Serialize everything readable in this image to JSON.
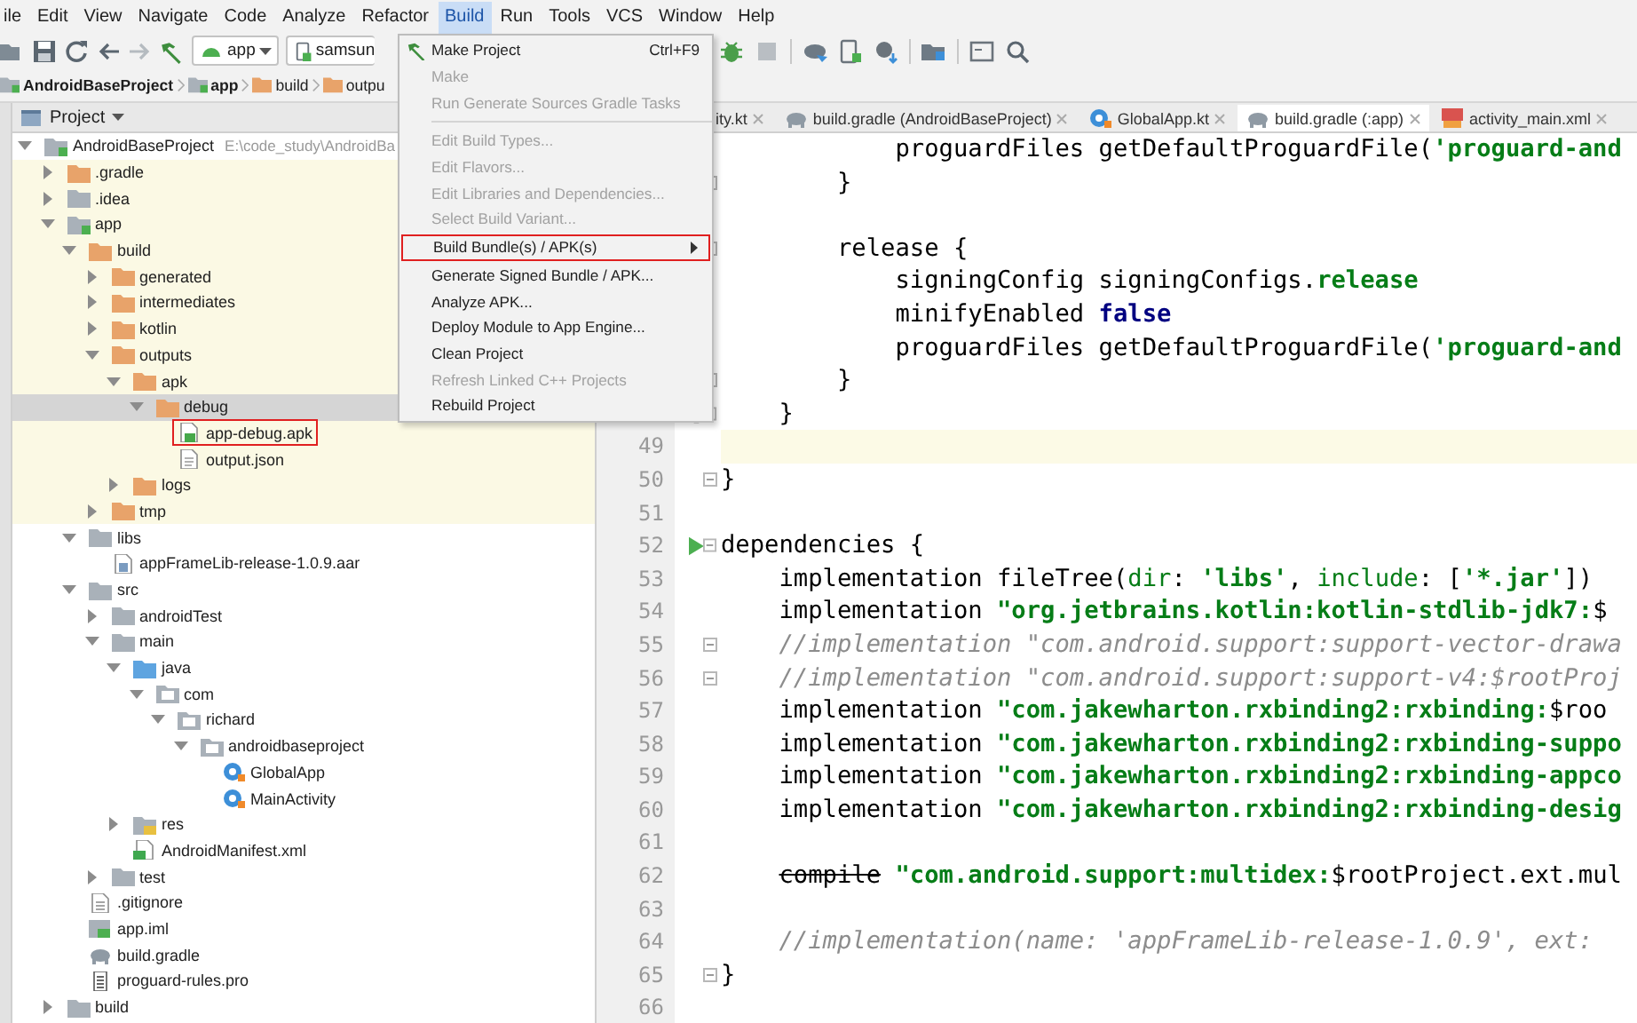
{
  "menu_bar": [
    {
      "label": "ile",
      "selected": false
    },
    {
      "label": "Edit",
      "selected": false
    },
    {
      "label": "View",
      "selected": false
    },
    {
      "label": "Navigate",
      "selected": false
    },
    {
      "label": "Code",
      "selected": false
    },
    {
      "label": "Analyze",
      "selected": false
    },
    {
      "label": "Refactor",
      "selected": false
    },
    {
      "label": "Build",
      "selected": true
    },
    {
      "label": "Run",
      "selected": false
    },
    {
      "label": "Tools",
      "selected": false
    },
    {
      "label": "VCS",
      "selected": false
    },
    {
      "label": "Window",
      "selected": false
    },
    {
      "label": "Help",
      "selected": false
    }
  ],
  "toolbar": {
    "run_config": "app",
    "device": "samsun"
  },
  "breadcrumb": [
    {
      "label": "AndroidBaseProject",
      "kind": "module"
    },
    {
      "label": "app",
      "kind": "module"
    },
    {
      "label": "build",
      "kind": "build-folder"
    },
    {
      "label": "outpu",
      "kind": "build-folder"
    }
  ],
  "project_panel": {
    "title": "Project",
    "tree": [
      {
        "label": "AndroidBaseProject",
        "path": "E:\\code_study\\AndroidBa",
        "kind": "module",
        "expanded": true,
        "selected": false,
        "shaded": false,
        "annotated": false,
        "children": [
          {
            "label": ".gradle",
            "kind": "build-folder",
            "expanded": false,
            "selected": false,
            "shaded": true,
            "annotated": false
          },
          {
            "label": ".idea",
            "kind": "folder",
            "expanded": false,
            "selected": false,
            "shaded": true,
            "annotated": false
          },
          {
            "label": "app",
            "kind": "module",
            "expanded": true,
            "selected": false,
            "shaded": true,
            "annotated": false,
            "children": [
              {
                "label": "build",
                "kind": "build-folder",
                "expanded": true,
                "selected": false,
                "shaded": true,
                "annotated": false,
                "children": [
                  {
                    "label": "generated",
                    "kind": "build-folder",
                    "expanded": false,
                    "selected": false,
                    "shaded": true,
                    "annotated": false
                  },
                  {
                    "label": "intermediates",
                    "kind": "build-folder",
                    "expanded": false,
                    "selected": false,
                    "shaded": true,
                    "annotated": false
                  },
                  {
                    "label": "kotlin",
                    "kind": "build-folder",
                    "expanded": false,
                    "selected": false,
                    "shaded": true,
                    "annotated": false
                  },
                  {
                    "label": "outputs",
                    "kind": "build-folder",
                    "expanded": true,
                    "selected": false,
                    "shaded": true,
                    "annotated": false,
                    "children": [
                      {
                        "label": "apk",
                        "kind": "build-folder",
                        "expanded": true,
                        "selected": false,
                        "shaded": true,
                        "annotated": false,
                        "children": [
                          {
                            "label": "debug",
                            "kind": "build-folder",
                            "expanded": true,
                            "selected": true,
                            "annotated": false,
                            "children": [
                              {
                                "label": "app-debug.apk",
                                "kind": "apk",
                                "selected": false,
                                "shaded": true,
                                "annotated": true
                              },
                              {
                                "label": "output.json",
                                "kind": "json",
                                "selected": false,
                                "shaded": true,
                                "annotated": false
                              }
                            ]
                          }
                        ]
                      },
                      {
                        "label": "logs",
                        "kind": "build-folder",
                        "expanded": false,
                        "selected": false,
                        "shaded": true,
                        "annotated": false
                      }
                    ]
                  },
                  {
                    "label": "tmp",
                    "kind": "build-folder",
                    "expanded": false,
                    "selected": false,
                    "shaded": true,
                    "annotated": false
                  }
                ]
              },
              {
                "label": "libs",
                "kind": "folder",
                "expanded": true,
                "selected": false,
                "shaded": false,
                "annotated": false,
                "children": [
                  {
                    "label": "appFrameLib-release-1.0.9.aar",
                    "kind": "aar",
                    "selected": false,
                    "shaded": false,
                    "annotated": false
                  }
                ]
              },
              {
                "label": "src",
                "kind": "folder",
                "expanded": true,
                "selected": false,
                "shaded": false,
                "annotated": false,
                "children": [
                  {
                    "label": "androidTest",
                    "kind": "folder",
                    "expanded": false,
                    "selected": false,
                    "shaded": false,
                    "annotated": false
                  },
                  {
                    "label": "main",
                    "kind": "folder",
                    "expanded": true,
                    "selected": false,
                    "shaded": false,
                    "annotated": false,
                    "children": [
                      {
                        "label": "java",
                        "kind": "source-folder",
                        "expanded": true,
                        "selected": false,
                        "shaded": false,
                        "annotated": false,
                        "children": [
                          {
                            "label": "com",
                            "kind": "package",
                            "expanded": true,
                            "selected": false,
                            "shaded": false,
                            "annotated": false,
                            "children": [
                              {
                                "label": "richard",
                                "kind": "package",
                                "expanded": true,
                                "selected": false,
                                "shaded": false,
                                "annotated": false,
                                "children": [
                                  {
                                    "label": "androidbaseproject",
                                    "kind": "package",
                                    "expanded": true,
                                    "selected": false,
                                    "shaded": false,
                                    "annotated": false,
                                    "children": [
                                      {
                                        "label": "GlobalApp",
                                        "kind": "kotlin-class",
                                        "selected": false,
                                        "shaded": false,
                                        "annotated": false
                                      },
                                      {
                                        "label": "MainActivity",
                                        "kind": "kotlin-class",
                                        "selected": false,
                                        "shaded": false,
                                        "annotated": false
                                      }
                                    ]
                                  }
                                ]
                              }
                            ]
                          }
                        ]
                      },
                      {
                        "label": "res",
                        "kind": "res-folder",
                        "expanded": false,
                        "selected": false,
                        "shaded": false,
                        "annotated": false
                      },
                      {
                        "label": "AndroidManifest.xml",
                        "kind": "manifest",
                        "selected": false,
                        "shaded": false,
                        "annotated": false
                      }
                    ]
                  },
                  {
                    "label": "test",
                    "kind": "folder",
                    "expanded": false,
                    "selected": false,
                    "shaded": false,
                    "annotated": false
                  }
                ]
              },
              {
                "label": ".gitignore",
                "kind": "text",
                "selected": false,
                "shaded": false,
                "annotated": false
              },
              {
                "label": "app.iml",
                "kind": "iml",
                "selected": false,
                "shaded": false,
                "annotated": false
              },
              {
                "label": "build.gradle",
                "kind": "gradle",
                "selected": false,
                "shaded": false,
                "annotated": false
              },
              {
                "label": "proguard-rules.pro",
                "kind": "pro",
                "selected": false,
                "shaded": false,
                "annotated": false
              }
            ]
          },
          {
            "label": "build",
            "kind": "folder",
            "expanded": false,
            "selected": false,
            "shaded": false,
            "annotated": false
          }
        ]
      }
    ]
  },
  "build_menu": [
    {
      "kind": "hammer-item",
      "label": "Make Project",
      "shortcut": "Ctrl+F9",
      "disabled": false,
      "submenu": false,
      "annotated": false
    },
    {
      "kind": "item",
      "label": "Make",
      "disabled": true,
      "submenu": false,
      "annotated": false
    },
    {
      "kind": "item",
      "label": "Run Generate Sources Gradle Tasks",
      "disabled": true,
      "submenu": false,
      "annotated": false
    },
    {
      "kind": "separator"
    },
    {
      "kind": "item",
      "label": "Edit Build Types...",
      "disabled": true,
      "submenu": false,
      "annotated": false
    },
    {
      "kind": "item",
      "label": "Edit Flavors...",
      "disabled": true,
      "submenu": false,
      "annotated": false
    },
    {
      "kind": "item",
      "label": "Edit Libraries and Dependencies...",
      "disabled": true,
      "submenu": false,
      "annotated": false
    },
    {
      "kind": "item",
      "label": "Select Build Variant...",
      "disabled": true,
      "submenu": false,
      "annotated": false
    },
    {
      "kind": "item",
      "label": "Build Bundle(s) / APK(s)",
      "disabled": false,
      "submenu": true,
      "annotated": true
    },
    {
      "kind": "item",
      "label": "Generate Signed Bundle / APK...",
      "disabled": false,
      "submenu": false,
      "annotated": false
    },
    {
      "kind": "item",
      "label": "Analyze APK...",
      "disabled": false,
      "submenu": false,
      "annotated": false
    },
    {
      "kind": "item",
      "label": "Deploy Module to App Engine...",
      "disabled": false,
      "submenu": false,
      "annotated": false
    },
    {
      "kind": "item",
      "label": "Clean Project",
      "disabled": false,
      "submenu": false,
      "annotated": false
    },
    {
      "kind": "item",
      "label": "Refresh Linked C++ Projects",
      "disabled": true,
      "submenu": false,
      "annotated": false
    },
    {
      "kind": "item",
      "label": "Rebuild Project",
      "disabled": false,
      "submenu": false,
      "annotated": false
    }
  ],
  "editor": {
    "tabs": [
      {
        "label": "ity.kt",
        "kind": "plain",
        "selected": false
      },
      {
        "label": "build.gradle (AndroidBaseProject)",
        "kind": "gradle",
        "selected": false
      },
      {
        "label": "GlobalApp.kt",
        "kind": "kotlin-class",
        "selected": false
      },
      {
        "label": "build.gradle (:app)",
        "kind": "gradle",
        "selected": true
      },
      {
        "label": "activity_main.xml",
        "kind": "layout",
        "selected": false
      }
    ],
    "lines": [
      {
        "kind": "code",
        "current": false,
        "fold": false,
        "segments": [
          {
            "kind": "plain",
            "text": "            proguardFiles getDefaultProguardFile("
          },
          {
            "kind": "string",
            "text": "'proguard-and"
          }
        ]
      },
      {
        "kind": "code",
        "current": false,
        "fold": true,
        "segments": [
          {
            "kind": "plain",
            "text": "        }"
          }
        ]
      },
      {
        "kind": "code",
        "current": false,
        "fold": false
      },
      {
        "kind": "code",
        "current": false,
        "fold": true,
        "segments": [
          {
            "kind": "plain",
            "text": "        release {"
          }
        ]
      },
      {
        "kind": "code",
        "current": false,
        "fold": false,
        "segments": [
          {
            "kind": "plain",
            "text": "            signingConfig signingConfigs."
          },
          {
            "kind": "string",
            "text": "release"
          }
        ]
      },
      {
        "kind": "code",
        "current": false,
        "fold": false,
        "segments": [
          {
            "kind": "plain",
            "text": "            minifyEnabled "
          },
          {
            "kind": "keyword",
            "text": "false"
          }
        ]
      },
      {
        "kind": "code",
        "current": false,
        "fold": false,
        "segments": [
          {
            "kind": "plain",
            "text": "            proguardFiles getDefaultProguardFile("
          },
          {
            "kind": "string",
            "text": "'proguard-and"
          }
        ]
      },
      {
        "kind": "code",
        "current": false,
        "fold": true,
        "segments": [
          {
            "kind": "plain",
            "text": "        }"
          }
        ]
      },
      {
        "kind": "bulb",
        "current": false,
        "fold": true,
        "segments": [
          {
            "kind": "plain",
            "text": "    }"
          }
        ]
      },
      {
        "kind": "code",
        "number": "49",
        "current": true,
        "fold": false
      },
      {
        "kind": "code",
        "number": "50",
        "current": false,
        "fold": true,
        "segments": [
          {
            "kind": "plain",
            "text": "}"
          }
        ]
      },
      {
        "kind": "code",
        "number": "51",
        "current": false,
        "fold": false
      },
      {
        "kind": "run",
        "number": "52",
        "current": false,
        "fold": true,
        "segments": [
          {
            "kind": "plain",
            "text": "dependencies {"
          }
        ]
      },
      {
        "kind": "code",
        "number": "53",
        "current": false,
        "fold": false,
        "segments": [
          {
            "kind": "plain",
            "text": "    implementation fileTree("
          },
          {
            "kind": "named-arg",
            "text": "dir"
          },
          {
            "kind": "plain",
            "text": ": "
          },
          {
            "kind": "string",
            "text": "'libs'"
          },
          {
            "kind": "plain",
            "text": ", "
          },
          {
            "kind": "named-arg",
            "text": "include"
          },
          {
            "kind": "plain",
            "text": ": ["
          },
          {
            "kind": "string",
            "text": "'*.jar'"
          },
          {
            "kind": "plain",
            "text": "])"
          }
        ]
      },
      {
        "kind": "code",
        "number": "54",
        "current": false,
        "fold": false,
        "segments": [
          {
            "kind": "plain",
            "text": "    implementation "
          },
          {
            "kind": "string",
            "text": "\"org.jetbrains.kotlin:kotlin-stdlib-jdk7:"
          },
          {
            "kind": "plain",
            "text": "$"
          }
        ]
      },
      {
        "kind": "code",
        "number": "55",
        "current": false,
        "fold": true,
        "segments": [
          {
            "kind": "comment",
            "text": "    //implementation \"com.android.support:support-vector-drawa"
          }
        ]
      },
      {
        "kind": "code",
        "number": "56",
        "current": false,
        "fold": true,
        "segments": [
          {
            "kind": "comment",
            "text": "    //implementation \"com.android.support:support-v4:$rootProj"
          }
        ]
      },
      {
        "kind": "code",
        "number": "57",
        "current": false,
        "fold": false,
        "segments": [
          {
            "kind": "plain",
            "text": "    implementation "
          },
          {
            "kind": "string",
            "text": "\"com.jakewharton.rxbinding2:rxbinding:"
          },
          {
            "kind": "plain",
            "text": "$roo"
          }
        ]
      },
      {
        "kind": "code",
        "number": "58",
        "current": false,
        "fold": false,
        "segments": [
          {
            "kind": "plain",
            "text": "    implementation "
          },
          {
            "kind": "string",
            "text": "\"com.jakewharton.rxbinding2:rxbinding-suppo"
          }
        ]
      },
      {
        "kind": "code",
        "number": "59",
        "current": false,
        "fold": false,
        "segments": [
          {
            "kind": "plain",
            "text": "    implementation "
          },
          {
            "kind": "string",
            "text": "\"com.jakewharton.rxbinding2:rxbinding-appco"
          }
        ]
      },
      {
        "kind": "code",
        "number": "60",
        "current": false,
        "fold": false,
        "segments": [
          {
            "kind": "plain",
            "text": "    implementation "
          },
          {
            "kind": "string",
            "text": "\"com.jakewharton.rxbinding2:rxbinding-desig"
          }
        ]
      },
      {
        "kind": "code",
        "number": "61",
        "current": false,
        "fold": false
      },
      {
        "kind": "code",
        "number": "62",
        "current": false,
        "fold": false,
        "segments": [
          {
            "kind": "deprecated",
            "text": "    compile"
          },
          {
            "kind": "string",
            "text": " \"com.android.support:multidex:"
          },
          {
            "kind": "plain",
            "text": "$rootProject.ext.mul"
          }
        ]
      },
      {
        "kind": "code",
        "number": "63",
        "current": false,
        "fold": false
      },
      {
        "kind": "code",
        "number": "64",
        "current": false,
        "fold": false,
        "segments": [
          {
            "kind": "comment",
            "text": "    //implementation(name: 'appFrameLib-release-1.0.9', ext:"
          }
        ]
      },
      {
        "kind": "code",
        "number": "65",
        "current": false,
        "fold": true,
        "segments": [
          {
            "kind": "plain",
            "text": "}"
          }
        ]
      },
      {
        "kind": "code",
        "number": "66",
        "current": false,
        "fold": false
      }
    ]
  }
}
